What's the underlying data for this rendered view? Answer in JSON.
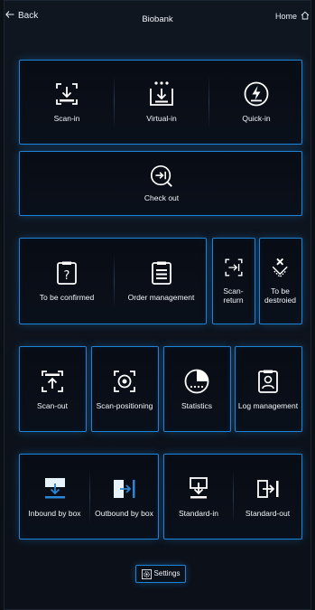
{
  "header": {
    "back_label": "Back",
    "title": "Biobank",
    "home_label": "Home"
  },
  "row1": {
    "scan_in": "Scan-in",
    "virtual_in": "Virtual-in",
    "quick_in": "Quick-in"
  },
  "row2": {
    "check_out": "Check out"
  },
  "row3": {
    "to_be_confirmed": "To be confirmed",
    "order_management": "Order management",
    "scan_return": "Scan-\nreturn",
    "to_be_destroied": "To be\ndestroied"
  },
  "row4": {
    "scan_out": "Scan-out",
    "scan_positioning": "Scan-positioning",
    "statistics": "Statistics",
    "log_management": "Log management"
  },
  "row5": {
    "inbound_by_box": "Inbound by box",
    "outbound_by_box": "Outbound by box",
    "standard_in": "Standard-in",
    "standard_out": "Standard-out"
  },
  "footer": {
    "settings_label": "Settings"
  },
  "colors": {
    "accent": "#1e84d8",
    "background": "#0b0f16",
    "text": "#ffffff"
  }
}
